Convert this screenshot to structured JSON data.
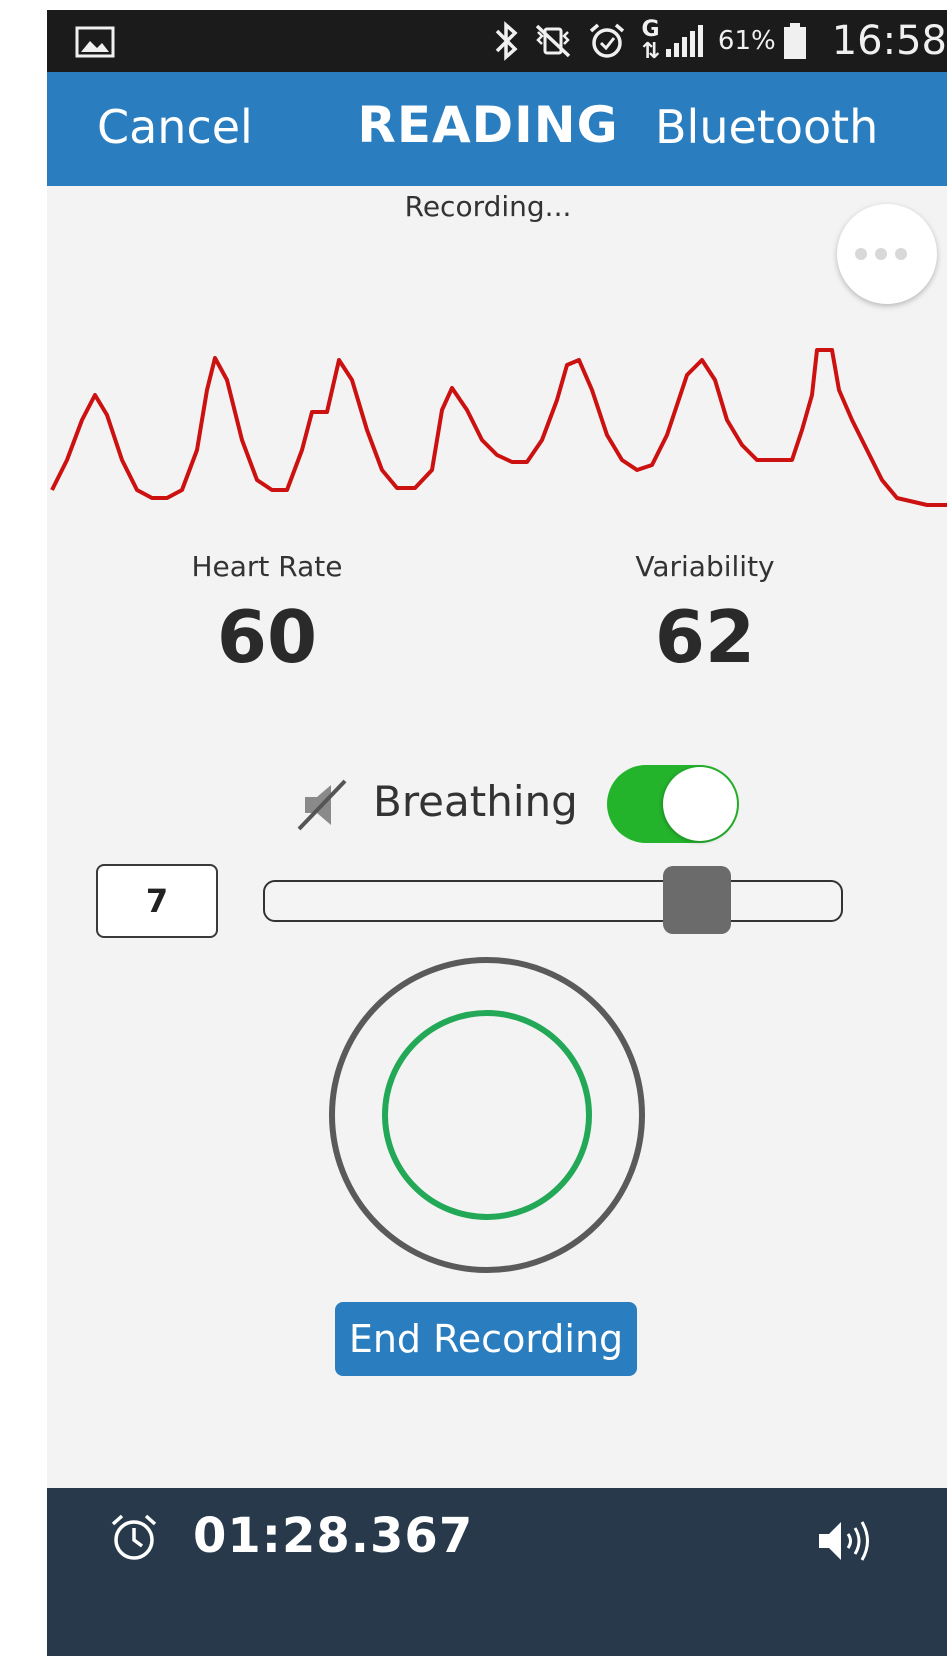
{
  "status_bar": {
    "battery_percent": "61%",
    "time": "16:58",
    "icons": [
      "gallery-icon",
      "bluetooth-icon",
      "vibrate-mute-icon",
      "alarm-icon",
      "signal-icon",
      "battery-icon"
    ]
  },
  "header": {
    "cancel_label": "Cancel",
    "title": "READING",
    "bluetooth_label": "Bluetooth"
  },
  "status_text": "Recording...",
  "waveform": {
    "color": "#cc1111"
  },
  "stats": {
    "heart_rate_label": "Heart Rate",
    "heart_rate_value": "60",
    "variability_label": "Variability",
    "variability_value": "62"
  },
  "breathing": {
    "label": "Breathing",
    "toggle_on": true,
    "sound_icon": "sound-off-icon"
  },
  "pace": {
    "value": "7",
    "slider_fraction": 0.75
  },
  "breath_circle": {
    "outer_color": "#5a5a5a",
    "inner_color": "#22a856"
  },
  "end_recording_label": "End Recording",
  "footer": {
    "timer": "01:28.367",
    "icons": [
      "alarm-clock-icon",
      "volume-icon"
    ]
  },
  "colors": {
    "accent": "#2a7ebf",
    "toggle_on": "#24b42c",
    "footer_bg": "#27394a"
  }
}
